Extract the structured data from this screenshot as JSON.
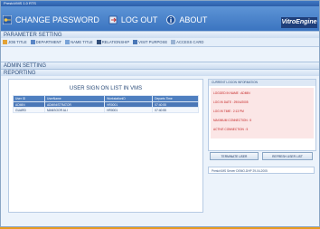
{
  "window": {
    "title": "PrestoVMS 1.0 RTS"
  },
  "top_menu": [
    {
      "label": "CHANGE PASSWORD",
      "icon": "key-icon"
    },
    {
      "label": "LOG OUT",
      "icon": "logout-icon"
    },
    {
      "label": "ABOUT",
      "icon": "info-icon"
    }
  ],
  "logo": {
    "text": "VitroEngine"
  },
  "sections": {
    "parameter_setting": "PARAMETER SETTING",
    "admin_setting": "ADMIN SETTING",
    "reporting": "REPORTING"
  },
  "parameter_items": [
    {
      "label": "JOB TITLE"
    },
    {
      "label": "DEPARTMENT"
    },
    {
      "label": "NAME TITLE"
    },
    {
      "label": "RELATIONSHIP"
    },
    {
      "label": "VISIT PURPOSE"
    },
    {
      "label": "ACCESS CARD"
    }
  ],
  "user_list": {
    "title": "USER SIGN ON LIST IN VMS",
    "columns": [
      "User ID",
      "UserName",
      "WorkstationID",
      "Departs Time"
    ],
    "rows": [
      {
        "cells": [
          "ADMIN",
          "ADMINISTRATOR",
          "HR0001",
          "07:40:55"
        ],
        "selected": true
      },
      {
        "cells": [
          "GUARD",
          "MANSOOR ALI",
          "HR0001",
          "07:40:55"
        ],
        "selected": false
      }
    ]
  },
  "info_panel": {
    "header": "CURRENT LOGON INFORMATION",
    "lines": [
      "LOGGED IN NAME : ADMIN",
      "LOG IN DATE : 29/04/2005",
      "LOG IN TIME : 2:13 PM",
      "MAXIMUM CONNECTION : 5",
      "ACTIVE CONNECTION : 5"
    ]
  },
  "buttons": {
    "terminate": "TERMINATE USER",
    "refresh": "REFRESH USER LIST"
  },
  "status_field": "PrestoVMS Server DEMO-DHP 29-04-2005"
}
